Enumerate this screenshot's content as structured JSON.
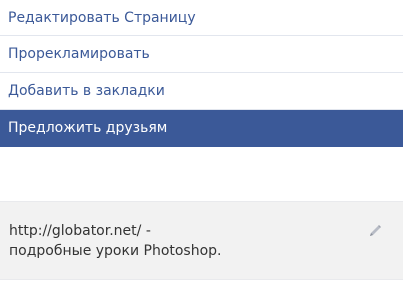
{
  "menu": {
    "items": [
      {
        "label": "Редактировать Страницу"
      },
      {
        "label": "Прорекламировать"
      },
      {
        "label": "Добавить в закладки"
      },
      {
        "label": "Предложить друзьям"
      }
    ]
  },
  "info": {
    "line1": "http://globator.net/ -",
    "line2": "подробные уроки Photoshop."
  },
  "icons": {
    "edit": "pencil-icon"
  },
  "colors": {
    "link": "#3b5998",
    "active_bg": "#3b5998",
    "active_text": "#ffffff",
    "info_bg": "#f2f2f2",
    "text": "#333333"
  }
}
